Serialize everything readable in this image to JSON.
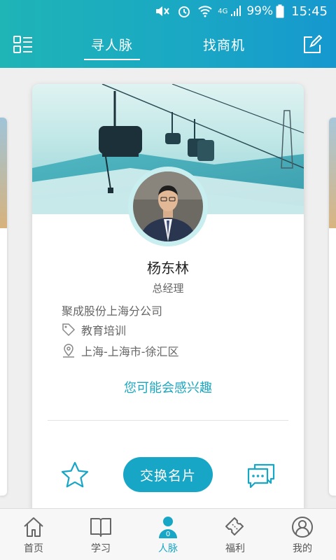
{
  "status_bar": {
    "battery_percent": "99%",
    "time": "15:45",
    "network": "4G",
    "icons": [
      "mute-icon",
      "alarm-icon",
      "wifi-icon",
      "signal-icon",
      "battery-icon"
    ]
  },
  "header": {
    "tabs": [
      {
        "label": "寻人脉",
        "active": true
      },
      {
        "label": "找商机",
        "active": false
      }
    ],
    "left_icon": "menu-list-icon",
    "right_icon": "edit-icon"
  },
  "profile_card": {
    "name": "杨东林",
    "title": "总经理",
    "company": "聚成股份上海分公司",
    "industry": "教育培训",
    "location": "上海-上海市-徐汇区",
    "interest_link": "您可能会感兴趣",
    "exchange_button": "交换名片",
    "icons": [
      "tag-icon",
      "location-pin-icon",
      "star-icon",
      "chat-icon"
    ]
  },
  "bottom_nav": {
    "items": [
      {
        "label": "首页",
        "icon": "home-icon",
        "active": false
      },
      {
        "label": "学习",
        "icon": "book-icon",
        "active": false
      },
      {
        "label": "人脉",
        "icon": "contacts-icon",
        "active": true,
        "badge": "0"
      },
      {
        "label": "福利",
        "icon": "ticket-icon",
        "active": false
      },
      {
        "label": "我的",
        "icon": "profile-icon",
        "active": false
      }
    ]
  },
  "colors": {
    "accent": "#18a6c6",
    "header_start": "#1fb4b6",
    "header_end": "#1698cf"
  }
}
